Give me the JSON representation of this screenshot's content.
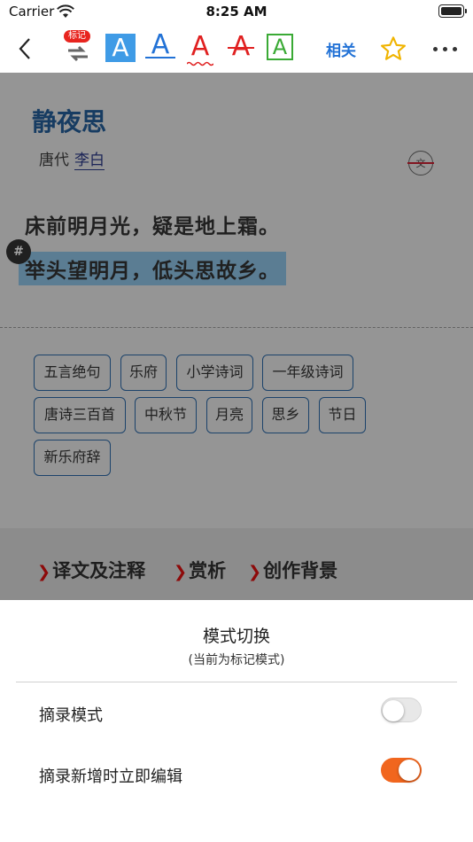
{
  "status_bar": {
    "carrier": "Carrier",
    "time": "8:25 AM"
  },
  "toolbar": {
    "badge": "标记",
    "a_label": "A",
    "related": "相关"
  },
  "poem": {
    "title": "静夜思",
    "dynasty": "唐代",
    "author": "李白",
    "translate_icon_label": "文",
    "lines": [
      "床前明月光，疑是地上霜。",
      "举头望明月，低头思故乡。"
    ],
    "hash": "#"
  },
  "tags": [
    "五言绝句",
    "乐府",
    "小学诗词",
    "一年级诗词",
    "唐诗三百首",
    "中秋节",
    "月亮",
    "思乡",
    "节日",
    "新乐府辞"
  ],
  "details": {
    "arrow": "❯",
    "links": [
      "译文及注释",
      "赏析",
      "创作背景"
    ]
  },
  "sheet": {
    "title": "模式切换",
    "subtitle": "(当前为标记模式)",
    "options": [
      {
        "label": "摘录模式",
        "on": false
      },
      {
        "label": "摘录新增时立即编辑",
        "on": true
      }
    ]
  },
  "colors": {
    "accent_toggle": "#f1661e",
    "title_blue": "#255e9a",
    "highlight": "#8fc4e6"
  }
}
